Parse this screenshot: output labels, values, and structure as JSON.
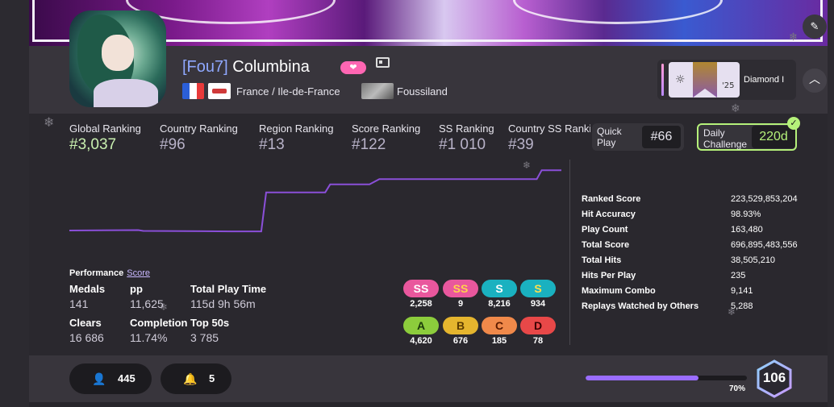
{
  "profile": {
    "tag": "[Fou7]",
    "name": "Columbina",
    "supporter_icon": "heart-icon",
    "location": "France / Ile-de-France",
    "team": "Foussiland",
    "flag_colors": [
      "#2b5fd8",
      "#ffffff",
      "#e83a3a"
    ]
  },
  "season": {
    "year": "'25",
    "label": "Diamond I"
  },
  "rankings": [
    {
      "label": "Global Ranking",
      "value": "#3,037"
    },
    {
      "label": "Country Ranking",
      "value": "#96"
    },
    {
      "label": "Region Ranking",
      "value": "#13"
    },
    {
      "label": "Score Ranking",
      "value": "#122"
    },
    {
      "label": "SS Ranking",
      "value": "#1 010"
    },
    {
      "label": "Country SS Ranking",
      "value": "#39"
    }
  ],
  "quick_play": {
    "label_line1": "Quick",
    "label_line2": "Play",
    "value": "#66"
  },
  "daily_challenge": {
    "label_line1": "Daily",
    "label_line2": "Challenge",
    "value": "220d"
  },
  "stats": [
    {
      "label": "Ranked Score",
      "value": "223,529,853,204"
    },
    {
      "label": "Hit Accuracy",
      "value": "98.93%"
    },
    {
      "label": "Play Count",
      "value": "163,480"
    },
    {
      "label": "Total Score",
      "value": "696,895,483,556"
    },
    {
      "label": "Total Hits",
      "value": "38,505,210"
    },
    {
      "label": "Hits Per Play",
      "value": "235"
    },
    {
      "label": "Maximum Combo",
      "value": "9,141"
    },
    {
      "label": "Replays Watched by Others",
      "value": "5,288"
    }
  ],
  "performance": {
    "heading": "Performance",
    "score_link": "Score",
    "medals": {
      "label": "Medals",
      "value": "141"
    },
    "pp": {
      "label": "pp",
      "value": "11,625"
    },
    "play_time": {
      "label": "Total Play Time",
      "value": "115d 9h 56m"
    },
    "clears": {
      "label": "Clears",
      "value": "16 686"
    },
    "completion": {
      "label": "Completion",
      "value": "11.74%"
    },
    "top50": {
      "label": "Top 50s",
      "value": "3 785"
    }
  },
  "grades": [
    {
      "label": "SS",
      "count": "2,258",
      "bg": "#e9579d",
      "fg": "#ffffff"
    },
    {
      "label": "SS",
      "count": "9",
      "bg": "#e9579d",
      "fg": "#ffd24d"
    },
    {
      "label": "S",
      "count": "8,216",
      "bg": "#1ab1c0",
      "fg": "#ffffff"
    },
    {
      "label": "S",
      "count": "934",
      "bg": "#1ab1c0",
      "fg": "#ffe04d"
    },
    {
      "label": "A",
      "count": "4,620",
      "bg": "#8ccc3c",
      "fg": "#1b3a0a"
    },
    {
      "label": "B",
      "count": "676",
      "bg": "#e5b52e",
      "fg": "#5a3a00"
    },
    {
      "label": "C",
      "count": "185",
      "bg": "#f0894a",
      "fg": "#5a1a00"
    },
    {
      "label": "D",
      "count": "78",
      "bg": "#e84848",
      "fg": "#3a0000"
    }
  ],
  "footer": {
    "followers": "445",
    "followers_icon": "user-icon",
    "mapping_subs": "5",
    "mapping_icon": "bell-icon",
    "level": "106",
    "level_progress": 0.7,
    "level_progress_label": "70%"
  },
  "history_line": [
    [
      0.0,
      0.2
    ],
    [
      0.14,
      0.205
    ],
    [
      0.15,
      0.195
    ],
    [
      0.33,
      0.19
    ],
    [
      0.39,
      0.19
    ],
    [
      0.4,
      0.63
    ],
    [
      0.52,
      0.63
    ],
    [
      0.53,
      0.72
    ],
    [
      0.61,
      0.72
    ],
    [
      0.63,
      0.78
    ],
    [
      0.95,
      0.78
    ],
    [
      0.96,
      0.88
    ],
    [
      1.0,
      0.88
    ]
  ]
}
